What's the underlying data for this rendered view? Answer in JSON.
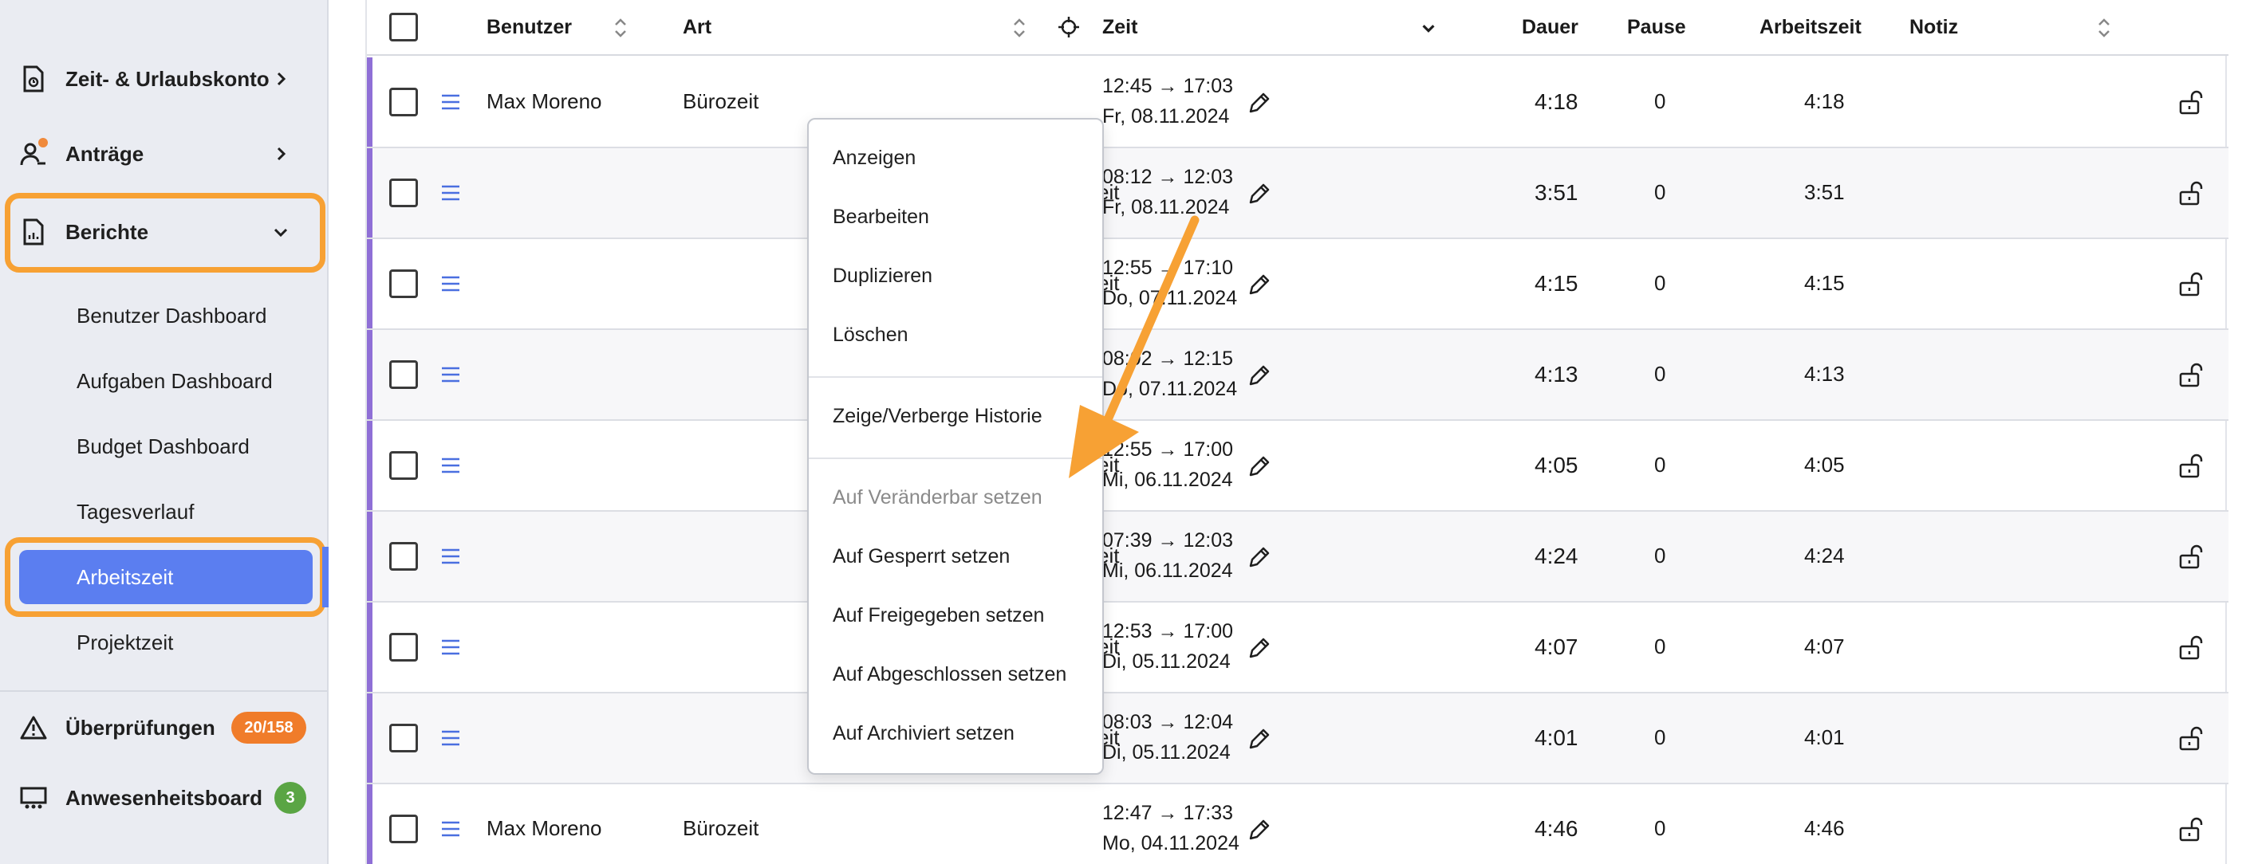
{
  "sidebar": {
    "items": [
      {
        "label": "Zeit- & Urlaubskonto"
      },
      {
        "label": "Anträge"
      },
      {
        "label": "Berichte"
      }
    ],
    "sub_items": [
      {
        "label": "Benutzer Dashboard"
      },
      {
        "label": "Aufgaben Dashboard"
      },
      {
        "label": "Budget Dashboard"
      },
      {
        "label": "Tagesverlauf"
      },
      {
        "label": "Arbeitszeit"
      },
      {
        "label": "Projektzeit"
      }
    ],
    "bottom_items": [
      {
        "label": "Überprüfungen",
        "badge": "20/158",
        "badge_color": "#f07c2a"
      },
      {
        "label": "Anwesenheitsboard",
        "badge": "3",
        "badge_color": "#5aa544"
      }
    ]
  },
  "table": {
    "headers": {
      "benutzer": "Benutzer",
      "art": "Art",
      "zeit": "Zeit",
      "dauer": "Dauer",
      "pause": "Pause",
      "arbeitszeit": "Arbeitszeit",
      "notiz": "Notiz"
    },
    "rows": [
      {
        "benutzer": "Max Moreno",
        "art": "Bürozeit",
        "zeit": "12:45 → 17:03",
        "datum": "Fr, 08.11.2024",
        "dauer": "4:18",
        "pause": "0",
        "arbeitszeit": "4:18"
      },
      {
        "benutzer": "",
        "art": "eit",
        "zeit": "08:12 → 12:03",
        "datum": "Fr, 08.11.2024",
        "dauer": "3:51",
        "pause": "0",
        "arbeitszeit": "3:51"
      },
      {
        "benutzer": "",
        "art": "eit",
        "zeit": "12:55 → 17:10",
        "datum": "Do, 07.11.2024",
        "dauer": "4:15",
        "pause": "0",
        "arbeitszeit": "4:15"
      },
      {
        "benutzer": "",
        "art": "t",
        "zeit": "08:02 → 12:15",
        "datum": "Do, 07.11.2024",
        "dauer": "4:13",
        "pause": "0",
        "arbeitszeit": "4:13"
      },
      {
        "benutzer": "",
        "art": "eit",
        "zeit": "12:55 → 17:00",
        "datum": "Mi, 06.11.2024",
        "dauer": "4:05",
        "pause": "0",
        "arbeitszeit": "4:05"
      },
      {
        "benutzer": "",
        "art": "eit",
        "zeit": "07:39 → 12:03",
        "datum": "Mi, 06.11.2024",
        "dauer": "4:24",
        "pause": "0",
        "arbeitszeit": "4:24"
      },
      {
        "benutzer": "",
        "art": "eit",
        "zeit": "12:53 → 17:00",
        "datum": "Di, 05.11.2024",
        "dauer": "4:07",
        "pause": "0",
        "arbeitszeit": "4:07"
      },
      {
        "benutzer": "",
        "art": "eit",
        "zeit": "08:03 → 12:04",
        "datum": "Di, 05.11.2024",
        "dauer": "4:01",
        "pause": "0",
        "arbeitszeit": "4:01"
      },
      {
        "benutzer": "Max Moreno",
        "art": "Bürozeit",
        "zeit": "12:47 → 17:33",
        "datum": "Mo, 04.11.2024",
        "dauer": "4:46",
        "pause": "0",
        "arbeitszeit": "4:46"
      }
    ]
  },
  "context_menu": {
    "items": [
      {
        "label": "Anzeigen"
      },
      {
        "label": "Bearbeiten"
      },
      {
        "label": "Duplizieren"
      },
      {
        "label": "Löschen"
      },
      {
        "label": "Zeige/Verberge Historie"
      },
      {
        "label": "Auf Veränderbar setzen",
        "disabled": true
      },
      {
        "label": "Auf Gesperrt setzen"
      },
      {
        "label": "Auf Freigegeben setzen"
      },
      {
        "label": "Auf Abgeschlossen setzen"
      },
      {
        "label": "Auf Archiviert setzen"
      }
    ]
  },
  "colors": {
    "accent": "#5b7ef0",
    "highlight": "#f7a134",
    "row_bar": "#8f6fd6",
    "menu_icon": "#4a6fe0"
  },
  "icons": {
    "sort": "sort-icon",
    "crosshair": "crosshair-icon",
    "pencil": "pencil-icon",
    "lock": "unlock-icon",
    "row_menu": "hamburger-icon"
  }
}
